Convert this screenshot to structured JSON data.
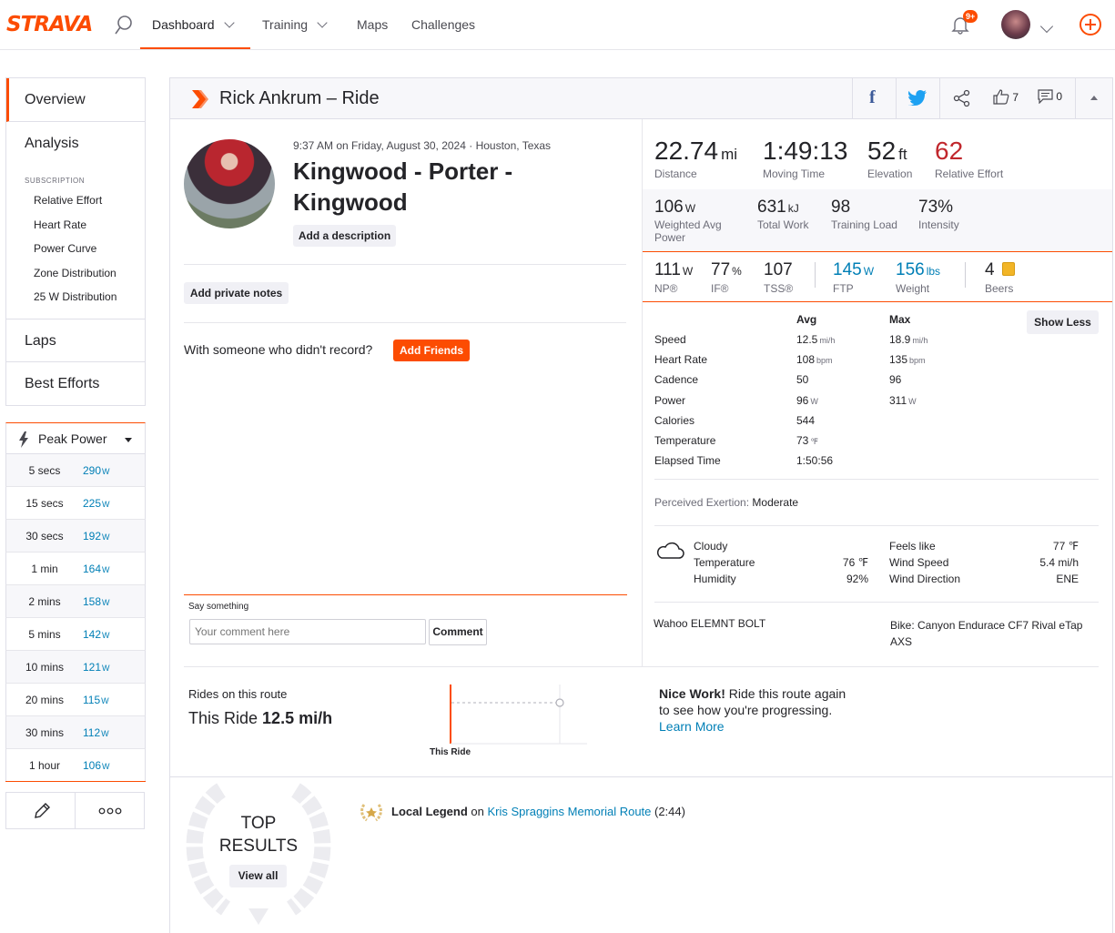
{
  "header": {
    "logo": "STRAVA",
    "nav": [
      {
        "label": "Dashboard"
      },
      {
        "label": "Training"
      },
      {
        "label": "Maps"
      },
      {
        "label": "Challenges"
      }
    ],
    "notif_badge": "9+"
  },
  "sidebar": {
    "items_top": [
      {
        "label": "Overview"
      },
      {
        "label": "Analysis"
      }
    ],
    "subscription_heading": "SUBSCRIPTION",
    "sub_items": [
      {
        "label": "Relative Effort"
      },
      {
        "label": "Heart Rate"
      },
      {
        "label": "Power Curve"
      },
      {
        "label": "Zone Distribution"
      },
      {
        "label": "25 W Distribution"
      }
    ],
    "items_bottom": [
      {
        "label": "Laps"
      },
      {
        "label": "Best Efforts"
      }
    ],
    "peak_power_label": "Peak Power",
    "peak_power": [
      {
        "label": "5 secs",
        "value": "290",
        "unit": "W"
      },
      {
        "label": "15 secs",
        "value": "225",
        "unit": "W"
      },
      {
        "label": "30 secs",
        "value": "192",
        "unit": "W"
      },
      {
        "label": "1 min",
        "value": "164",
        "unit": "W"
      },
      {
        "label": "2 mins",
        "value": "158",
        "unit": "W"
      },
      {
        "label": "5 mins",
        "value": "142",
        "unit": "W"
      },
      {
        "label": "10 mins",
        "value": "121",
        "unit": "W"
      },
      {
        "label": "20 mins",
        "value": "115",
        "unit": "W"
      },
      {
        "label": "30 mins",
        "value": "112",
        "unit": "W"
      },
      {
        "label": "1 hour",
        "value": "106",
        "unit": "W"
      }
    ]
  },
  "activity": {
    "heading": "Rick Ankrum – Ride",
    "kudos": "7",
    "comments": "0",
    "datetime": "9:37 AM on Friday, August 30, 2024 · Houston, Texas",
    "name_line1": "Kingwood - Porter -",
    "name_line2": "Kingwood",
    "add_description": "Add a description",
    "add_private_notes": "Add private notes",
    "with_someone": "With someone who didn't record?",
    "add_friends": "Add Friends",
    "say_something": "Say something",
    "comment_placeholder": "Your comment here",
    "comment_button": "Comment"
  },
  "stats": {
    "primary": [
      {
        "value": "22.74",
        "unit": "mi",
        "label": "Distance"
      },
      {
        "value": "1:49:13",
        "unit": "",
        "label": "Moving Time"
      },
      {
        "value": "52",
        "unit": "ft",
        "label": "Elevation"
      },
      {
        "value": "62",
        "unit": "",
        "label": "Relative Effort"
      }
    ],
    "secondary": [
      {
        "value": "106",
        "unit": "W",
        "label": "Weighted Avg Power"
      },
      {
        "value": "631",
        "unit": "kJ",
        "label": "Total Work"
      },
      {
        "value": "98",
        "unit": "",
        "label": "Training Load"
      },
      {
        "value": "73%",
        "unit": "",
        "label": "Intensity"
      }
    ],
    "tertiary": [
      {
        "value": "111",
        "unit": "W",
        "label": "NP®"
      },
      {
        "value": "77",
        "unit": "%",
        "label": "IF®"
      },
      {
        "value": "107",
        "unit": "",
        "label": "TSS®"
      },
      {
        "value": "145",
        "unit": "W",
        "label": "FTP"
      },
      {
        "value": "156",
        "unit": "lbs",
        "label": "Weight"
      },
      {
        "value": "4",
        "unit": "",
        "label": "Beers"
      }
    ],
    "table_headers": {
      "avg": "Avg",
      "max": "Max"
    },
    "show_less": "Show Less",
    "rows": [
      {
        "label": "Speed",
        "avg": "12.5",
        "avg_unit": "mi/h",
        "max": "18.9",
        "max_unit": "mi/h"
      },
      {
        "label": "Heart Rate",
        "avg": "108",
        "avg_unit": "bpm",
        "max": "135",
        "max_unit": "bpm"
      },
      {
        "label": "Cadence",
        "avg": "50",
        "avg_unit": "",
        "max": "96",
        "max_unit": ""
      },
      {
        "label": "Power",
        "avg": "96",
        "avg_unit": "W",
        "max": "311",
        "max_unit": "W"
      },
      {
        "label": "Calories",
        "avg": "544",
        "avg_unit": "",
        "max": "",
        "max_unit": ""
      },
      {
        "label": "Temperature",
        "avg": "73",
        "avg_unit": "℉",
        "max": "",
        "max_unit": ""
      },
      {
        "label": "Elapsed Time",
        "avg": "1:50:56",
        "avg_unit": "",
        "max": "",
        "max_unit": ""
      }
    ],
    "perceived_label": "Perceived Exertion:",
    "perceived_value": "Moderate",
    "weather": {
      "condition": "Cloudy",
      "temperature_label": "Temperature",
      "temperature": "76 ℉",
      "humidity_label": "Humidity",
      "humidity": "92%",
      "feels_label": "Feels like",
      "feels": "77 ℉",
      "wind_speed_label": "Wind Speed",
      "wind_speed": "5.4 mi/h",
      "wind_dir_label": "Wind Direction",
      "wind_dir": "ENE"
    },
    "device": "Wahoo ELEMNT BOLT",
    "bike": "Bike: Canyon Endurace CF7 Rival eTap AXS"
  },
  "route": {
    "heading": "Rides on this route",
    "this_ride_label": "This Ride",
    "this_ride_value": "12.5 mi/h",
    "chart_label": "This Ride",
    "nice_work": "Nice Work!",
    "nice_work_rest1": " Ride this route again",
    "nice_work_rest2": "to see how you're progressing.",
    "learn_more": "Learn More"
  },
  "results": {
    "top1": "TOP",
    "top2": "RESULTS",
    "view_all": "View all",
    "legend_bold": "Local Legend",
    "legend_on": " on ",
    "legend_route": "Kris Spraggins Memorial Route",
    "legend_count": " (2:44)"
  },
  "colors": {
    "brand": "#fc4c02",
    "link": "#007fb6",
    "relative_effort": "#c1272d"
  }
}
